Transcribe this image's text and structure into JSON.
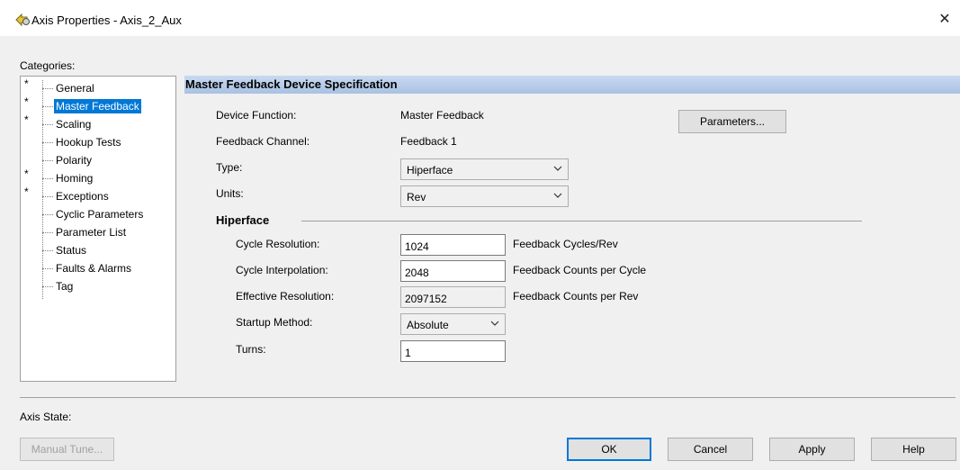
{
  "window": {
    "title": "Axis Properties - Axis_2_Aux",
    "close_glyph": "✕"
  },
  "categories": {
    "label": "Categories:",
    "items": [
      {
        "label": "General",
        "starred": true,
        "selected": false
      },
      {
        "label": "Master Feedback",
        "starred": true,
        "selected": true
      },
      {
        "label": "Scaling",
        "starred": true,
        "selected": false
      },
      {
        "label": "Hookup Tests",
        "starred": false,
        "selected": false
      },
      {
        "label": "Polarity",
        "starred": false,
        "selected": false
      },
      {
        "label": "Homing",
        "starred": true,
        "selected": false
      },
      {
        "label": "Exceptions",
        "starred": true,
        "selected": false
      },
      {
        "label": "Cyclic Parameters",
        "starred": false,
        "selected": false
      },
      {
        "label": "Parameter List",
        "starred": false,
        "selected": false
      },
      {
        "label": "Status",
        "starred": false,
        "selected": false
      },
      {
        "label": "Faults & Alarms",
        "starred": false,
        "selected": false
      },
      {
        "label": "Tag",
        "starred": false,
        "selected": false
      }
    ],
    "star_glyph": "*"
  },
  "section": {
    "title": "Master Feedback Device Specification",
    "device_function_label": "Device Function:",
    "device_function_value": "Master Feedback",
    "feedback_channel_label": "Feedback Channel:",
    "feedback_channel_value": "Feedback 1",
    "type_label": "Type:",
    "type_value": "Hiperface",
    "units_label": "Units:",
    "units_value": "Rev",
    "parameters_button": "Parameters..."
  },
  "hiperface": {
    "heading": "Hiperface",
    "cycle_resolution_label": "Cycle Resolution:",
    "cycle_resolution_value": "1024",
    "cycle_resolution_unit": "Feedback Cycles/Rev",
    "cycle_interpolation_label": "Cycle Interpolation:",
    "cycle_interpolation_value": "2048",
    "cycle_interpolation_unit": "Feedback Counts per Cycle",
    "effective_resolution_label": "Effective Resolution:",
    "effective_resolution_value": "2097152",
    "effective_resolution_unit": "Feedback Counts per Rev",
    "startup_method_label": "Startup Method:",
    "startup_method_value": "Absolute",
    "turns_label": "Turns:",
    "turns_value": "1"
  },
  "footer": {
    "axis_state_label": "Axis State:",
    "manual_tune_button": "Manual Tune...",
    "ok_button": "OK",
    "cancel_button": "Cancel",
    "apply_button": "Apply",
    "help_button": "Help"
  },
  "colors": {
    "selection": "#0078d7",
    "section_bar": "#b8cde9",
    "dialog_bg": "#f0f0f0"
  }
}
